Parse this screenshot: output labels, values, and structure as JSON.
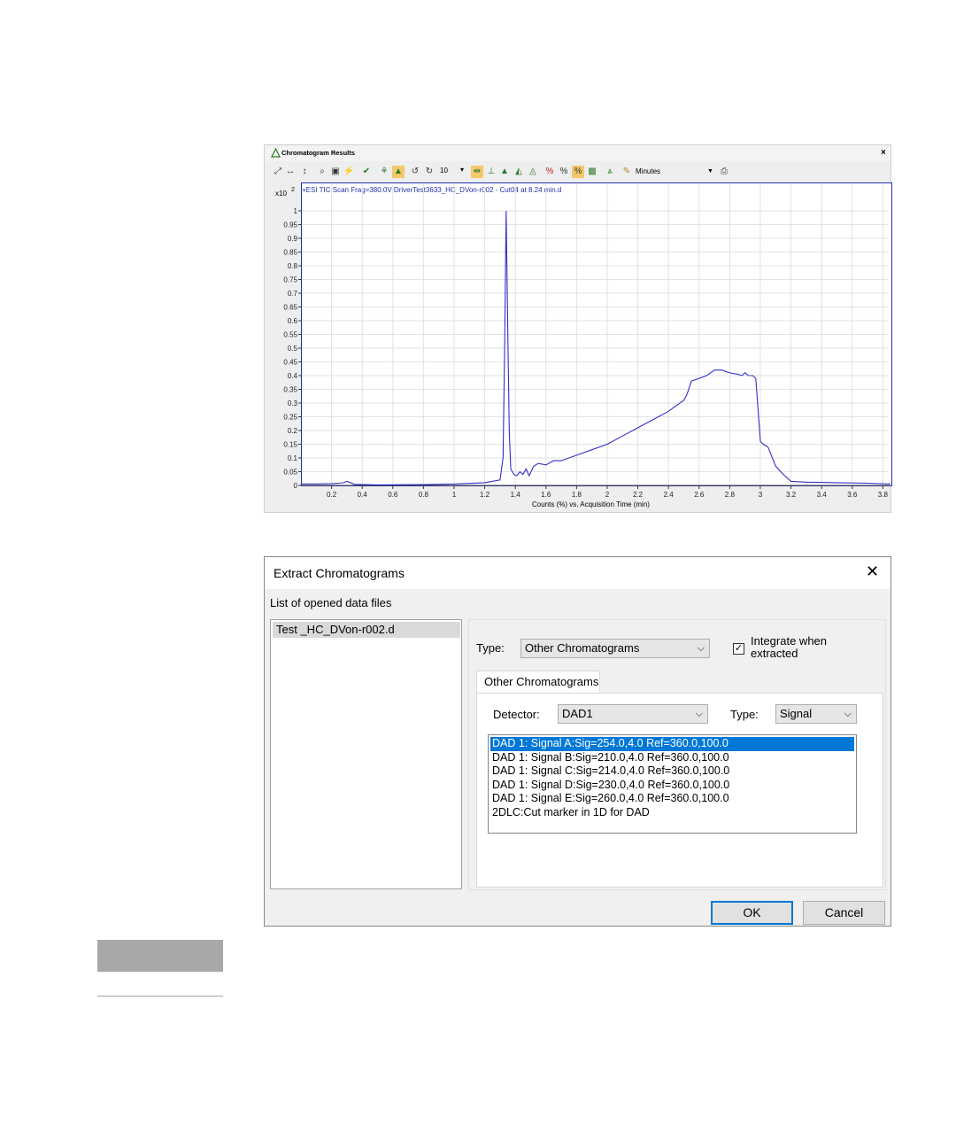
{
  "chrom_window": {
    "title": "Chromatogram Results",
    "close": "×",
    "toolbar": {
      "zoom_value": "10",
      "units": "Minutes",
      "icons": [
        "autoscale-xy-icon",
        "autoscale-x-icon",
        "autoscale-y-icon",
        "zoom-icon",
        "fit-icon",
        "peak-icon",
        "integrate-icon",
        "baseline-icon",
        "highlight-icon",
        "undo-icon",
        "redo-icon",
        "dropdown-icon",
        "peak-label-icon",
        "bar-icon",
        "peak-find-icon",
        "manual-integrate-icon",
        "manual-baseline-icon",
        "percent-red-icon",
        "percent-icon",
        "percent-hl-icon",
        "compare-icon",
        "export-icon",
        "units-icon",
        "print-icon"
      ]
    },
    "plot": {
      "scale_label": "x10",
      "scale_exp": "2",
      "trace_label": "+ESI TIC Scan Frag=380.0V DriverTest3633_HC_DVon-r002 - Cut04 at 8.24 min.d",
      "xlabel": "Counts (%) vs. Acquisition Time (min)"
    }
  },
  "chart_data": {
    "type": "line",
    "title": "",
    "xlabel": "Counts (%) vs. Acquisition Time (min)",
    "ylabel": "",
    "xlim": [
      0.0,
      3.85
    ],
    "ylim": [
      0,
      1.0
    ],
    "x_ticks": [
      "0.2",
      "0.4",
      "0.6",
      "0.8",
      "1",
      "1.2",
      "1.4",
      "1.6",
      "1.8",
      "2",
      "2.2",
      "2.4",
      "2.6",
      "2.8",
      "3",
      "3.2",
      "3.4",
      "3.6",
      "3.8"
    ],
    "y_ticks": [
      "0",
      "0.05",
      "0.1",
      "0.15",
      "0.2",
      "0.25",
      "0.3",
      "0.35",
      "0.4",
      "0.45",
      "0.5",
      "0.55",
      "0.6",
      "0.65",
      "0.7",
      "0.75",
      "0.8",
      "0.85",
      "0.9",
      "0.95",
      "1"
    ],
    "grid": true,
    "series": [
      {
        "color": "#3030c8",
        "x": [
          0.0,
          0.1,
          0.2,
          0.25,
          0.28,
          0.3,
          0.35,
          0.5,
          0.8,
          1.0,
          1.2,
          1.3,
          1.32,
          1.33,
          1.34,
          1.35,
          1.36,
          1.37,
          1.39,
          1.41,
          1.43,
          1.45,
          1.47,
          1.49,
          1.52,
          1.55,
          1.6,
          1.65,
          1.7,
          1.8,
          1.9,
          2.0,
          2.1,
          2.2,
          2.3,
          2.4,
          2.45,
          2.5,
          2.52,
          2.55,
          2.6,
          2.65,
          2.7,
          2.75,
          2.8,
          2.85,
          2.88,
          2.9,
          2.92,
          2.95,
          2.97,
          3.0,
          3.02,
          3.05,
          3.1,
          3.15,
          3.2,
          3.3,
          3.5,
          3.7,
          3.85
        ],
        "y": [
          0.005,
          0.005,
          0.006,
          0.008,
          0.01,
          0.015,
          0.004,
          0.002,
          0.003,
          0.005,
          0.01,
          0.02,
          0.1,
          0.5,
          1.0,
          0.6,
          0.2,
          0.06,
          0.04,
          0.035,
          0.05,
          0.04,
          0.06,
          0.035,
          0.07,
          0.08,
          0.075,
          0.09,
          0.09,
          0.11,
          0.13,
          0.15,
          0.18,
          0.21,
          0.24,
          0.27,
          0.29,
          0.31,
          0.33,
          0.38,
          0.39,
          0.4,
          0.42,
          0.42,
          0.41,
          0.405,
          0.4,
          0.41,
          0.4,
          0.4,
          0.39,
          0.16,
          0.15,
          0.14,
          0.07,
          0.04,
          0.015,
          0.012,
          0.01,
          0.008,
          0.005
        ]
      }
    ]
  },
  "dialog": {
    "title": "Extract Chromatograms",
    "close": "✕",
    "files_label": "List of opened data files",
    "files": [
      "Test _HC_DVon-r002.d"
    ],
    "type_label": "Type:",
    "type_value": "Other Chromatograms",
    "integrate_checked": "✓",
    "integrate_label": "Integrate when extracted",
    "tab_label": "Other Chromatograms",
    "detector_label": "Detector:",
    "detector_value": "DAD1",
    "sigtype_label": "Type:",
    "sigtype_value": "Signal",
    "signals": [
      "DAD 1: Signal A:Sig=254.0,4.0  Ref=360.0,100.0",
      "DAD 1: Signal B:Sig=210.0,4.0  Ref=360.0,100.0",
      "DAD 1: Signal C:Sig=214.0,4.0  Ref=360.0,100.0",
      "DAD 1: Signal D:Sig=230.0,4.0  Ref=360.0,100.0",
      "DAD 1: Signal E:Sig=260.0,4.0  Ref=360.0,100.0",
      "2DLC:Cut marker in 1D for DAD"
    ],
    "selected_signal": 0,
    "ok_label": "OK",
    "cancel_label": "Cancel",
    "combo_arrow": "⌵"
  }
}
